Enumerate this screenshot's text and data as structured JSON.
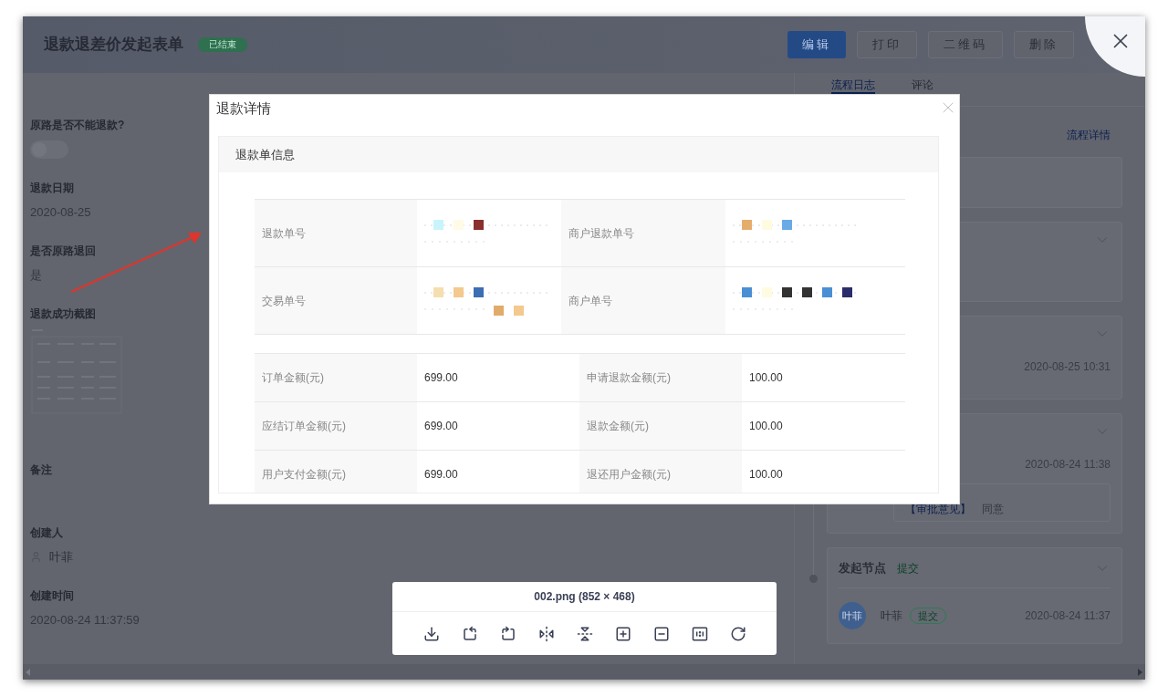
{
  "window": {
    "title": "退款退差价发起表单",
    "status_badge": "已结束",
    "buttons": [
      {
        "label": "编辑",
        "primary": true
      },
      {
        "label": "打印",
        "primary": false
      },
      {
        "label": "二维码",
        "primary": false
      },
      {
        "label": "删除",
        "primary": false
      }
    ]
  },
  "form_fields": [
    {
      "kind": "switch",
      "label": "原路是否不能退款?",
      "on": false
    },
    {
      "kind": "text",
      "label": "退款日期",
      "value": "2020-08-25"
    },
    {
      "kind": "text",
      "label": "是否原路退回",
      "value": "是"
    },
    {
      "kind": "image",
      "label": "退款成功截图"
    },
    {
      "kind": "text",
      "label": "备注"
    },
    {
      "kind": "user",
      "label": "创建人",
      "value": "叶菲"
    },
    {
      "kind": "text",
      "label": "创建时间",
      "value": "2020-08-24 11:37:59"
    }
  ],
  "side_panel": {
    "tabs": [
      {
        "label": "流程日志",
        "selected": true
      },
      {
        "label": "评论",
        "selected": false
      }
    ],
    "detail_link": "流程详情",
    "cards": [
      {
        "kind": "blank"
      },
      {
        "kind": "collapsed"
      },
      {
        "kind": "log",
        "time": "2020-08-25 10:31"
      },
      {
        "kind": "log",
        "time": "2020-08-24 11:38",
        "comment_label": "【审批意见】",
        "comment": "同意"
      },
      {
        "kind": "node",
        "title": "发起节点",
        "status": "提交",
        "avatar": "叶菲",
        "user": "叶菲",
        "user_tag": "提交",
        "time": "2020-08-24 11:37"
      }
    ]
  },
  "modal": {
    "title": "退款详情",
    "section": "退款单信息",
    "id_rows": [
      {
        "label_1": "退款单号",
        "label_2": "商户退款单号"
      },
      {
        "label_1": "交易单号",
        "label_2": "商户单号"
      }
    ],
    "amount_rows": [
      {
        "label_1": "订单金额(元)",
        "value_1": "699.00",
        "label_2": "申请退款金额(元)",
        "value_2": "100.00"
      },
      {
        "label_1": "应结订单金额(元)",
        "value_1": "699.00",
        "label_2": "退款金额(元)",
        "value_2": "100.00"
      },
      {
        "label_1": "用户支付金额(元)",
        "value_1": "699.00",
        "label_2": "退还用户金额(元)",
        "value_2": "100.00"
      }
    ]
  },
  "viewer": {
    "caption": "002.png (852 × 468)"
  }
}
